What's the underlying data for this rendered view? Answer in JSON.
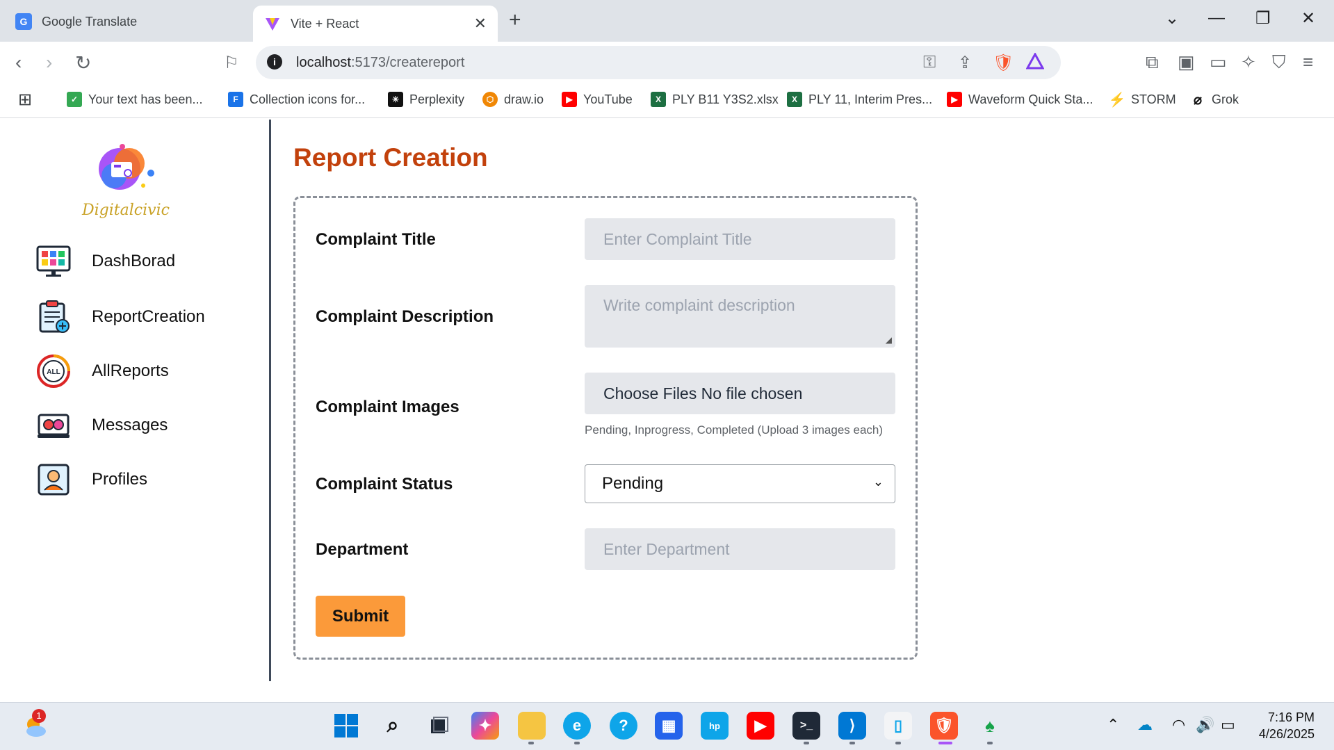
{
  "browser": {
    "tabs": [
      {
        "title": "Google Translate",
        "active": false
      },
      {
        "title": "Vite + React",
        "active": true
      }
    ],
    "url_host": "localhost",
    "url_path": ":5173/createreport",
    "bookmarks": [
      {
        "label": "Your text has been...",
        "icon": "check-icon",
        "color": "#34a853"
      },
      {
        "label": "Collection icons for...",
        "icon": "flaticon-icon",
        "color": "#1a73e8"
      },
      {
        "label": "Perplexity",
        "icon": "perplexity-icon",
        "color": "#111111"
      },
      {
        "label": "draw.io",
        "icon": "drawio-icon",
        "color": "#f08705"
      },
      {
        "label": "YouTube",
        "icon": "youtube-icon",
        "color": "#ff0000"
      },
      {
        "label": "PLY B11 Y3S2.xlsx",
        "icon": "excel-icon",
        "color": "#1d6f42"
      },
      {
        "label": "PLY 11, Interim Pres...",
        "icon": "excel-icon",
        "color": "#1d6f42"
      },
      {
        "label": "Waveform Quick Sta...",
        "icon": "youtube-icon",
        "color": "#ff0000"
      },
      {
        "label": "STORM",
        "icon": "bolt-icon",
        "color": "#1a73e8"
      },
      {
        "label": "Grok",
        "icon": "grok-icon",
        "color": "#111111"
      }
    ]
  },
  "sidebar": {
    "logo_text": "Digitalcivic",
    "items": [
      {
        "label": "DashBorad",
        "icon": "dashboard-icon"
      },
      {
        "label": "ReportCreation",
        "icon": "report-creation-icon"
      },
      {
        "label": "AllReports",
        "icon": "all-reports-icon"
      },
      {
        "label": "Messages",
        "icon": "messages-icon"
      },
      {
        "label": "Profiles",
        "icon": "profiles-icon"
      }
    ]
  },
  "main": {
    "title": "Report Creation",
    "form": {
      "title_label": "Complaint Title",
      "title_placeholder": "Enter Complaint Title",
      "description_label": "Complaint Description",
      "description_placeholder": "Write complaint description",
      "images_label": "Complaint Images",
      "images_button": "Choose Files",
      "images_status": "No file chosen",
      "images_hint": "Pending, Inprogress, Completed (Upload 3 images each)",
      "status_label": "Complaint Status",
      "status_value": "Pending",
      "department_label": "Department",
      "department_placeholder": "Enter Department",
      "submit_label": "Submit"
    }
  },
  "taskbar": {
    "weather_badge": "1",
    "time": "7:16 PM",
    "date": "4/26/2025"
  },
  "colors": {
    "title": "#c2410c",
    "submit": "#fb9a3a",
    "input_bg": "#e5e7eb"
  }
}
